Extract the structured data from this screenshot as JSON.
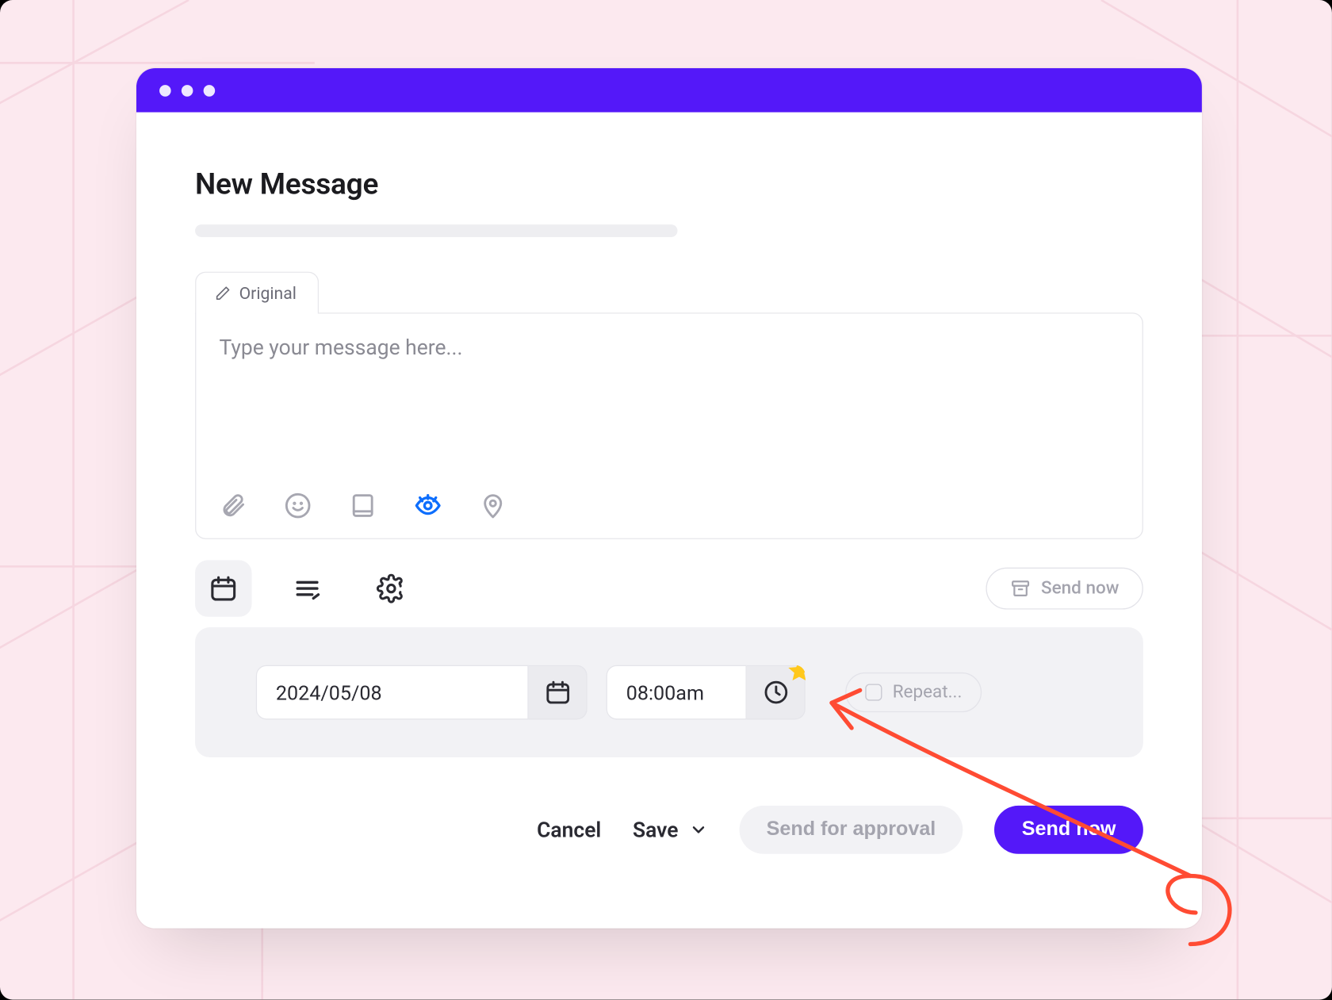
{
  "page_title": "New Message",
  "tab": {
    "label": "Original"
  },
  "editor": {
    "placeholder": "Type your message here..."
  },
  "icons": {
    "attachment": "paperclip-icon",
    "emoji": "smile-icon",
    "template": "square-icon",
    "preview": "eye-icon",
    "location": "pin-icon"
  },
  "schedule_tabs": {
    "calendar": "calendar-icon",
    "queue": "queue-icon",
    "settings": "gear-icon"
  },
  "send_now_chip": "Send now",
  "schedule": {
    "date": "2024/05/08",
    "time": "08:00am",
    "repeat_label": "Repeat..."
  },
  "footer": {
    "cancel": "Cancel",
    "save": "Save",
    "approval": "Send for approval",
    "send_now": "Send now"
  },
  "colors": {
    "accent": "#5418F9",
    "bg": "#fce9ef",
    "blue": "#0D6EFD",
    "star": "#FFC81C",
    "arrow": "#FF4B33"
  }
}
